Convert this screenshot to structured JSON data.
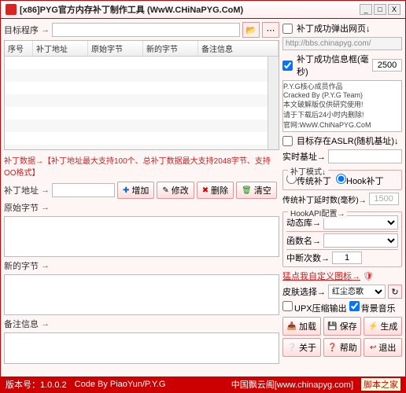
{
  "title": "[x86]PYG官方内存补丁制作工具 (WwW.CHiNaPYG.CoM)",
  "winbtns": {
    "min": "_",
    "max": "□",
    "close": "X"
  },
  "target": {
    "label": "目标程序",
    "arrow": "→"
  },
  "table": {
    "cols": [
      "序号",
      "补丁地址",
      "原始字节",
      "新的字节",
      "备注信息"
    ]
  },
  "patchdata": {
    "header": "补丁数据→【补丁地址最大支持100个、总补丁数据最大支持2048字节、支持OO格式】",
    "addr_label": "补丁地址",
    "arrow": "→",
    "orig_label": "原始字节",
    "new_label": "新的字节",
    "note_label": "备注信息",
    "btn_add": "增加",
    "btn_edit": "修改",
    "btn_del": "删除",
    "btn_clear": "清空"
  },
  "opt": {
    "popup": "补丁成功弹出网页↓",
    "url": "http://bbs.chinapyg.com/",
    "msgbox": "补丁成功信息框(毫秒)",
    "msgbox_val": "2500",
    "credits": "P.Y.G核心成员作品\nCracked By (P.Y.G Team)\n本文破解版仅供研究使用!\n请于下载后24小时内删除!\n官网:WwW.ChiNaPYG.CoM",
    "aslr": "目标存在ASLR(随机基址)↓",
    "realtime": "实时基址→"
  },
  "mode": {
    "legend": "补丁模式↓",
    "trad": "传统补丁",
    "hook": "Hook补丁"
  },
  "delay": {
    "label": "传统补丁延时数(毫秒)→",
    "val": "1500"
  },
  "hookapi": {
    "legend": "HookAPI配置→",
    "dll": "动态库→",
    "fn": "函数名→",
    "intnum": "中断次数→",
    "intval": "1"
  },
  "custom": {
    "label": "猛点我自定义图标→"
  },
  "skin": {
    "label": "皮肤选择→",
    "value": "红尘恋歌"
  },
  "upx": {
    "compress": "UPX压缩输出",
    "bgm": "背景音乐"
  },
  "actions": {
    "load": "加载",
    "save": "保存",
    "gen": "生成",
    "about": "关于",
    "help": "帮助",
    "exit": "退出"
  },
  "status": {
    "ver_label": "版本号：",
    "ver": "1.0.0.2",
    "author": "Code By PiaoYun/P.Y.G",
    "site": "中国飘云阁[www.chinapyg.com]",
    "brand": "脚本之家"
  },
  "icons": {
    "folder": "📂",
    "dots": "⋯",
    "plus": "✚",
    "edit": "✎",
    "del": "✖",
    "clear": "🗑",
    "save": "💾",
    "gen": "⚡",
    "about": "❔",
    "help": "❓",
    "exit": "↩",
    "load": "📥",
    "refresh": "↻",
    "shield": "🛡"
  }
}
